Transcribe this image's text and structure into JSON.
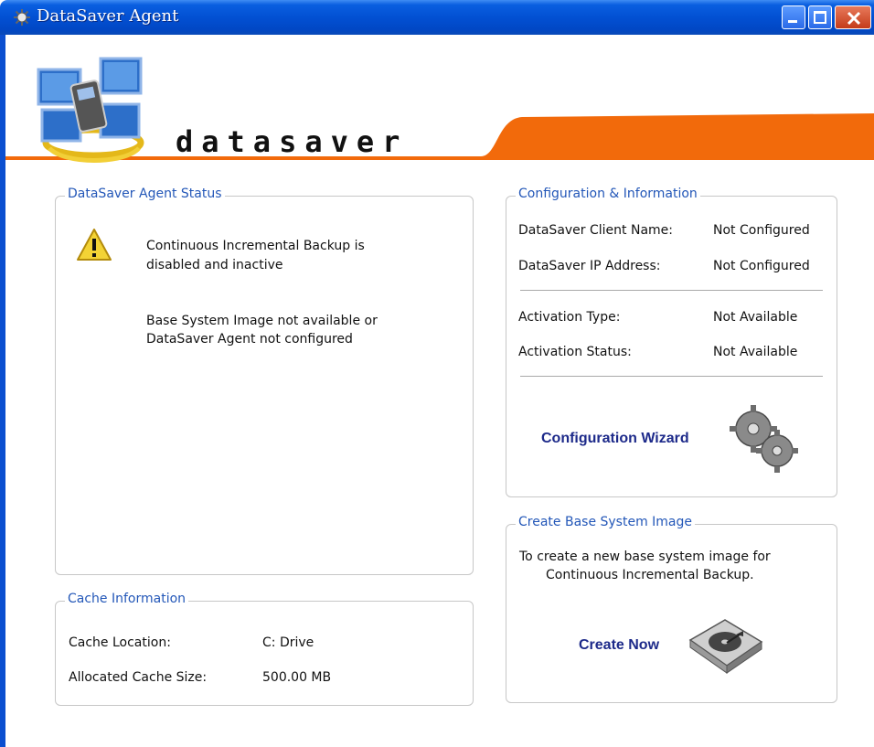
{
  "window": {
    "title": "DataSaver Agent",
    "controls": [
      "minimize",
      "maximize",
      "close"
    ]
  },
  "banner": {
    "brand": "datasaver",
    "accent_color": "#f26a0b"
  },
  "status": {
    "legend": "DataSaver Agent Status",
    "icon": "warning-icon",
    "line1a": "Continuous Incremental Backup is",
    "line1b": "disabled and inactive",
    "line2a": "Base System Image not available or",
    "line2b": "DataSaver Agent not configured"
  },
  "cache": {
    "legend": "Cache Information",
    "rows": [
      {
        "label": "Cache Location:",
        "value": "C: Drive"
      },
      {
        "label": "Allocated Cache Size:",
        "value": "500.00 MB"
      }
    ]
  },
  "config": {
    "legend": "Configuration & Information",
    "rows": [
      {
        "label": "DataSaver Client Name:",
        "value": "Not Configured"
      },
      {
        "label": "DataSaver IP Address:",
        "value": "Not Configured"
      },
      {
        "label": "Activation Type:",
        "value": "Not Available"
      },
      {
        "label": "Activation Status:",
        "value": "Not Available"
      }
    ],
    "wizard_label": "Configuration Wizard",
    "wizard_icon": "gears-icon"
  },
  "image": {
    "legend": "Create Base System Image",
    "desc1": "To create a new base system image for",
    "desc2": "Continuous Incremental Backup.",
    "create_label": "Create Now",
    "create_icon": "hard-drive-icon"
  }
}
